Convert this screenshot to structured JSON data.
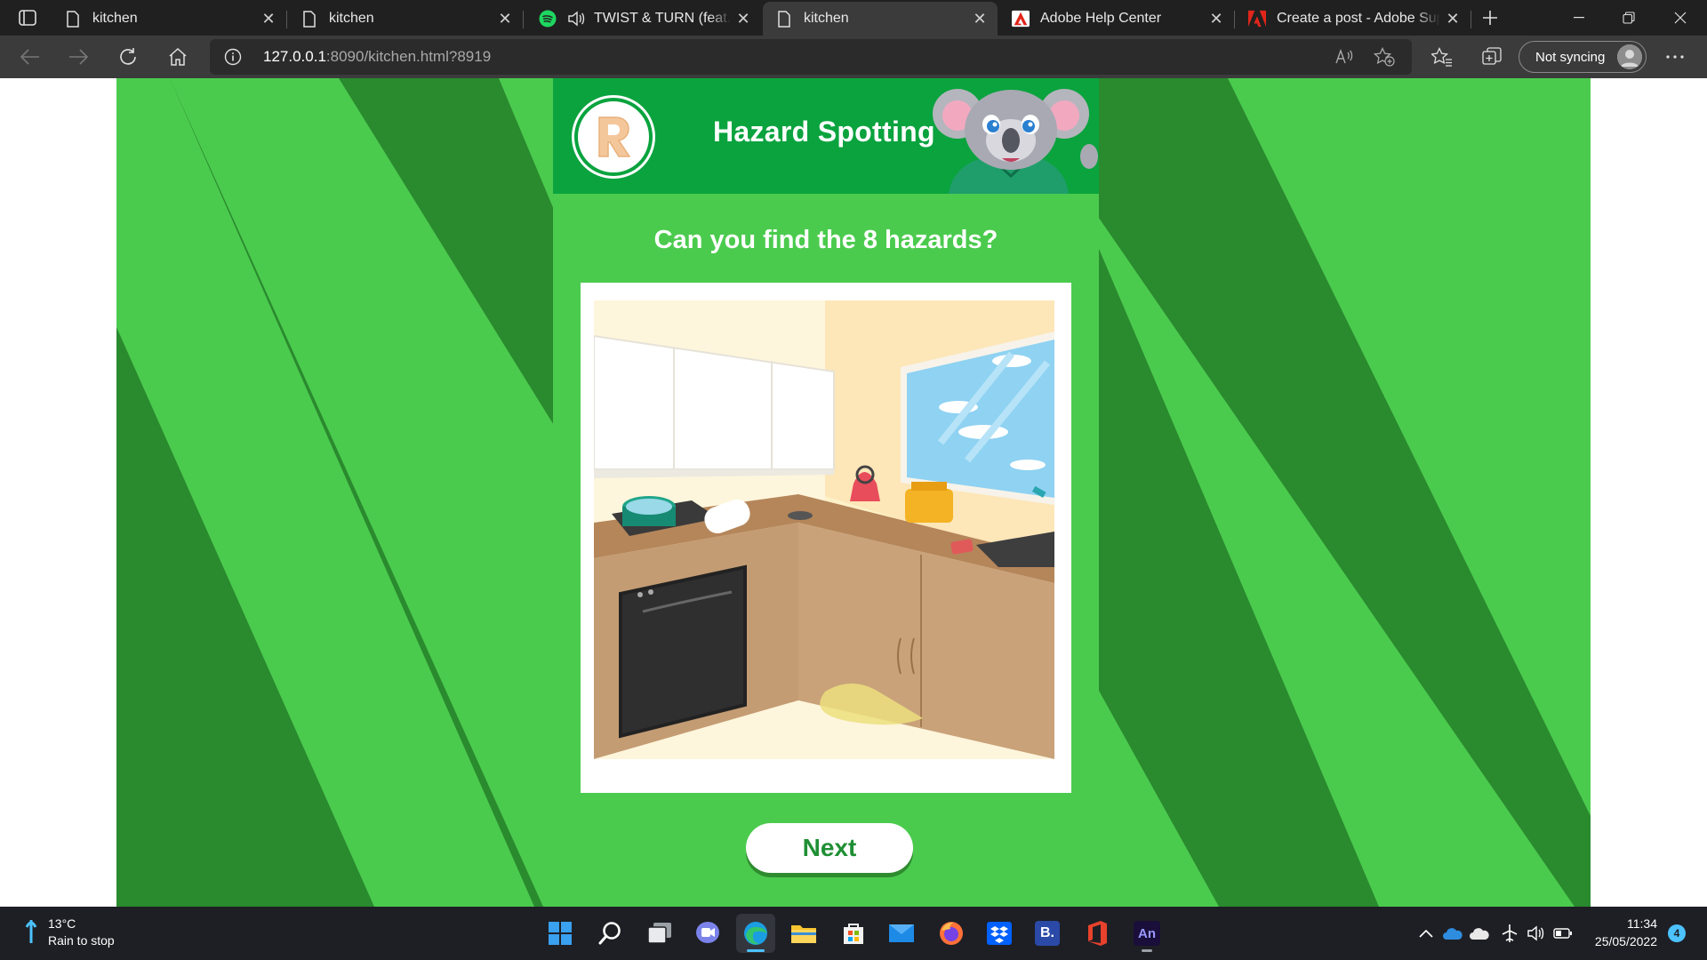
{
  "browser": {
    "tabs": [
      {
        "title": "kitchen",
        "icon": "page-icon"
      },
      {
        "title": "kitchen",
        "icon": "page-icon"
      },
      {
        "title": "TWIST & TURN (feat. D",
        "icon": "spotify-icon"
      },
      {
        "title": "kitchen",
        "icon": "page-icon",
        "active": true
      },
      {
        "title": "Adobe Help Center",
        "icon": "adobe-icon"
      },
      {
        "title": "Create a post - Adobe Supp",
        "icon": "adobe-icon"
      }
    ],
    "url_host": "127.0.0.1",
    "url_rest": ":8090/kitchen.html?8919",
    "sync_label": "Not syncing"
  },
  "game": {
    "header_title": "Hazard Spotting",
    "question": "Can you find the 8 hazards?",
    "next_label": "Next",
    "colors": {
      "bg": "#4bcb4e",
      "stripe": "#2a8a2e",
      "header": "#0aa33e"
    }
  },
  "taskbar": {
    "weather_temp": "13°C",
    "weather_desc": "Rain to stop",
    "apps": [
      "start-icon",
      "search-icon",
      "task-view-icon",
      "teams-chat-icon",
      "edge-icon",
      "file-explorer-icon",
      "store-icon",
      "mail-icon",
      "firefox-icon",
      "dropbox-icon",
      "b-app-icon",
      "office-icon",
      "animate-icon"
    ],
    "b_app_label": "B.",
    "animate_label": "An",
    "time": "11:34",
    "date": "25/05/2022",
    "notifications": "4"
  }
}
